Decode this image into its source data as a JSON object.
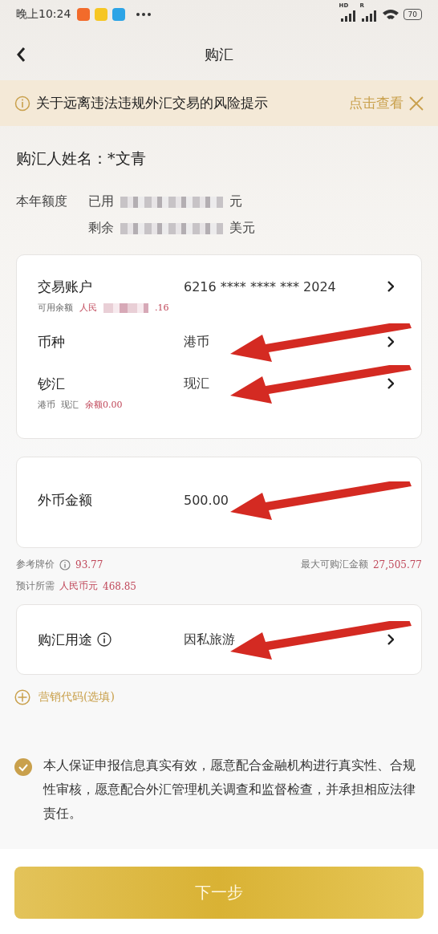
{
  "status_bar": {
    "time": "晚上10:24",
    "signal_labels": [
      "HD",
      "R"
    ],
    "battery": "70"
  },
  "header": {
    "title": "购汇"
  },
  "notice": {
    "text": "关于远离违法违规外汇交易的风险提示",
    "link": "点击查看"
  },
  "buyer_name": "购汇人姓名：*文青",
  "quota": {
    "label": "本年额度",
    "used_label": "已用",
    "used_unit": "元",
    "remaining_label": "剩余",
    "remaining_unit": "美元"
  },
  "cards": [
    {
      "rows": [
        {
          "label": "交易账户",
          "value": "6216 **** **** *** 2024",
          "chevron": true,
          "annotated": false,
          "sub": {
            "label": "可用余额",
            "value_start": "人民",
            "value_end": ".16",
            "redacted": true
          }
        },
        {
          "label": "币种",
          "value": "港币",
          "chevron": true,
          "annotated": true
        },
        {
          "label": "钞汇",
          "value": "现汇",
          "chevron": true,
          "annotated": true,
          "sub": {
            "label": "港币  现汇",
            "value_start": "余额0.00",
            "redacted": false
          }
        }
      ]
    },
    {
      "rows": [
        {
          "label": "外币金额",
          "value": "500.00",
          "chevron": false,
          "annotated": true
        }
      ]
    }
  ],
  "rate_info": {
    "rate_label": "参考牌价",
    "rate": "93.77",
    "max_label": "最大可购汇金额",
    "max": "27,505.77",
    "need_label": "预计所需",
    "need_currency": "人民币元",
    "need": "468.85"
  },
  "purpose": {
    "label": "购汇用途",
    "value": "因私旅游",
    "chevron": true,
    "annotated": true
  },
  "marketing": "营销代码(选填)",
  "agreement": {
    "checked": true,
    "text": "本人保证申报信息真实有效，愿意配合金融机构进行真实性、合规性审核，愿意配合外汇管理机关调查和监督检查，并承担相应法律责任。"
  },
  "next_button": "下一步"
}
